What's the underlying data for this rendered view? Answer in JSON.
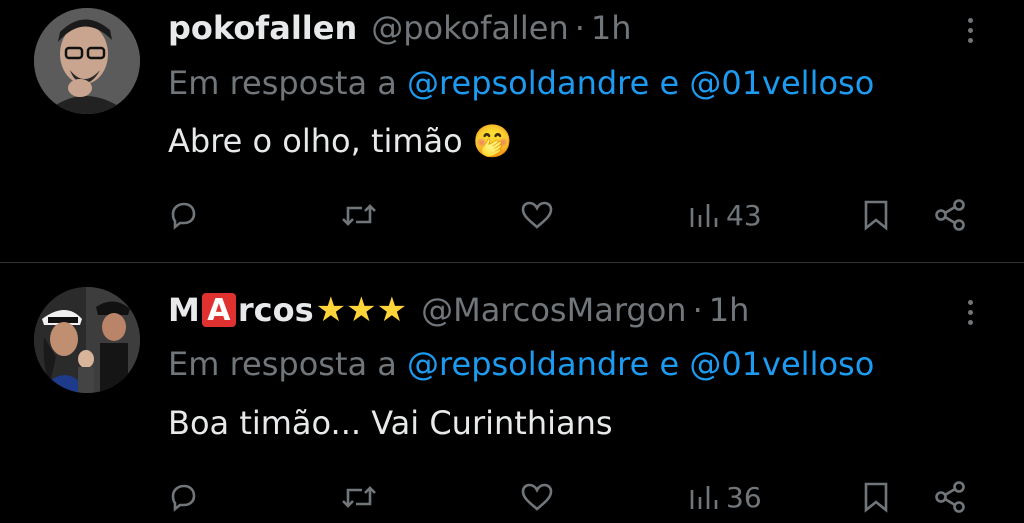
{
  "tweets": [
    {
      "display_name": "pokofallen",
      "handle": "@pokofallen",
      "separator": "·",
      "time": "1h",
      "reply_prefix": "Em resposta a",
      "mention_1": "@repsoldandre",
      "reply_join": "e",
      "mention_2": "@01velloso",
      "text": "Abre o olho, timão",
      "emoji": "🤭",
      "views": "43"
    },
    {
      "display_name_part1": "M",
      "display_name_badge": "A",
      "display_name_part2": "rcos",
      "stars": "★★★",
      "handle": "@MarcosMargon",
      "separator": "·",
      "time": "1h",
      "reply_prefix": "Em resposta a",
      "mention_1": "@repsoldandre",
      "reply_join": "e",
      "mention_2": "@01velloso",
      "text": "Boa timão... Vai Curinthians",
      "views": "36"
    }
  ],
  "icons": {
    "reply": "reply-icon",
    "retweet": "retweet-icon",
    "like": "heart-icon",
    "views": "views-icon",
    "bookmark": "bookmark-icon",
    "share": "share-icon",
    "more": "more-icon"
  },
  "colors": {
    "background": "#000000",
    "text": "#e7e9ea",
    "muted": "#71767b",
    "mention": "#1d9bf0",
    "divider": "#2f3336"
  }
}
